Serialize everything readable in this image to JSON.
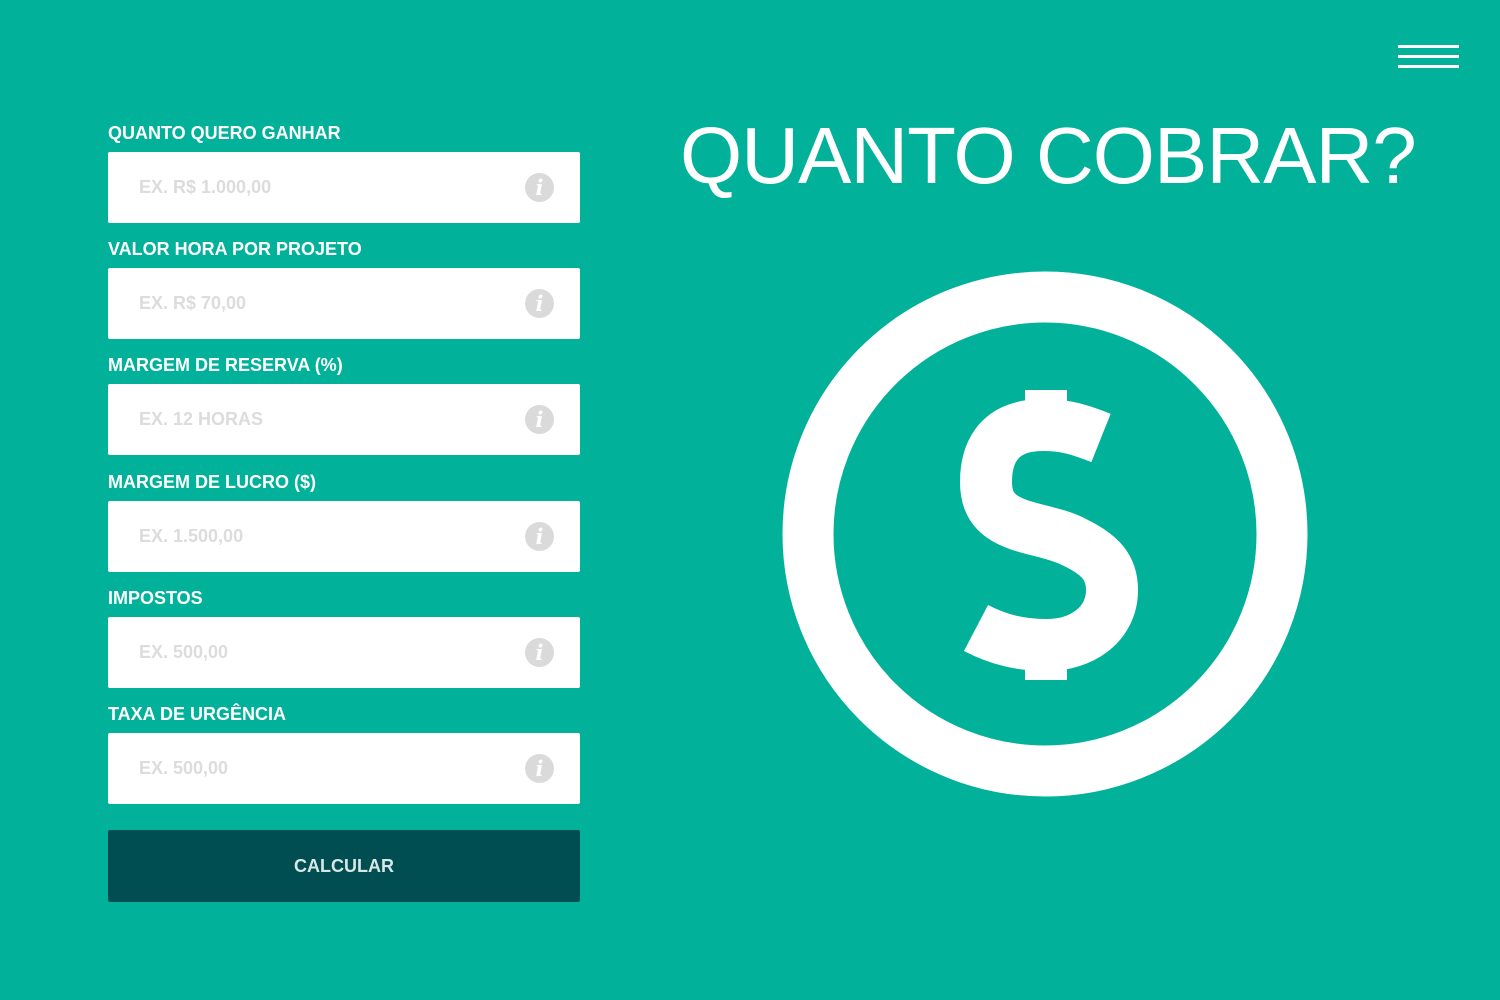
{
  "colors": {
    "background": "#02b199",
    "field_background": "#ffffff",
    "label_text": "#ffffff",
    "placeholder_text": "#dcdcdc",
    "info_icon": "#dadada",
    "button_background": "#004e52",
    "button_text": "#d9e6e6",
    "title_text": "#ffffff",
    "coin": "#ffffff",
    "menu_bars": "#ffffff"
  },
  "header": {
    "menu_icon": "hamburger-menu-icon"
  },
  "main": {
    "title": "QUANTO COBRAR?",
    "illustration_icon": "dollar-coin-icon"
  },
  "form": {
    "fields": [
      {
        "label": "QUANTO QUERO GANHAR",
        "placeholder": "EX. R$ 1.000,00",
        "value": "",
        "info_icon": "info-icon"
      },
      {
        "label": "VALOR HORA POR PROJETO",
        "placeholder": "EX. R$ 70,00",
        "value": "",
        "info_icon": "info-icon"
      },
      {
        "label": "MARGEM DE RESERVA (%)",
        "placeholder": "EX. 12 HORAS",
        "value": "",
        "info_icon": "info-icon"
      },
      {
        "label": "MARGEM DE LUCRO ($)",
        "placeholder": "EX. 1.500,00",
        "value": "",
        "info_icon": "info-icon"
      },
      {
        "label": "IMPOSTOS",
        "placeholder": "EX. 500,00",
        "value": "",
        "info_icon": "info-icon"
      },
      {
        "label": "TAXA DE URGÊNCIA",
        "placeholder": "EX. 500,00",
        "value": "",
        "info_icon": "info-icon"
      }
    ],
    "submit_label": "CALCULAR",
    "info_glyph": "i"
  }
}
